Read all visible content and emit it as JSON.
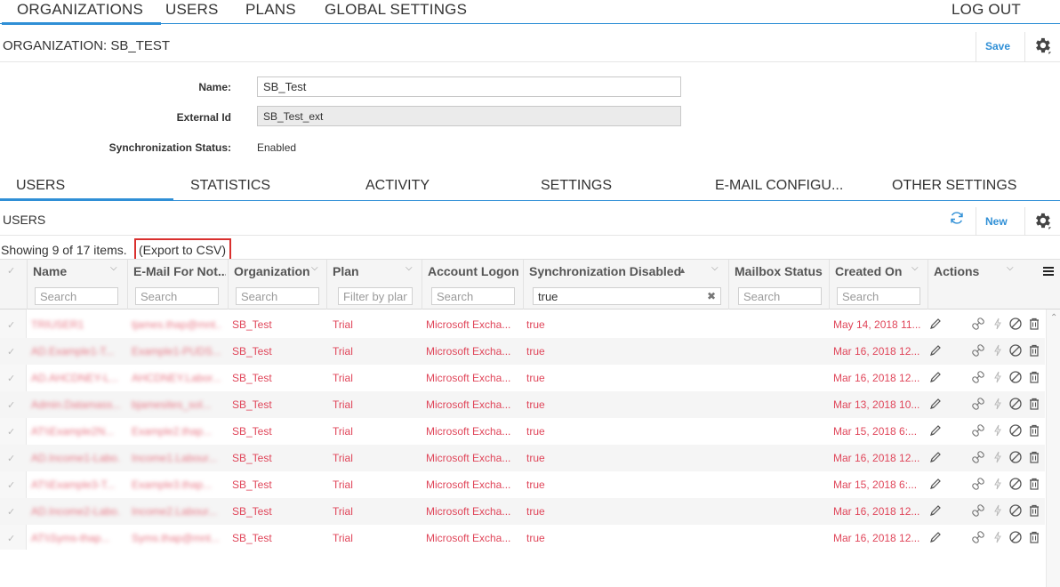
{
  "topnav": {
    "items": [
      "ORGANIZATIONS",
      "USERS",
      "PLANS",
      "GLOBAL SETTINGS"
    ],
    "logout": "LOG OUT"
  },
  "org": {
    "title": "ORGANIZATION: SB_TEST",
    "save": "Save",
    "fields": {
      "name_label": "Name:",
      "name_value": "SB_Test",
      "external_label": "External Id",
      "external_value": "SB_Test_ext",
      "sync_label": "Synchronization Status:",
      "sync_value": "Enabled"
    }
  },
  "subtabs": [
    "USERS",
    "STATISTICS",
    "ACTIVITY",
    "SETTINGS",
    "E-MAIL CONFIGU...",
    "OTHER SETTINGS"
  ],
  "users": {
    "title": "USERS",
    "new": "New",
    "showing": "Showing 9 of 17 items.",
    "export": "(Export to CSV)"
  },
  "grid": {
    "columns": [
      {
        "title": "Name",
        "placeholder": "Search"
      },
      {
        "title": "E-Mail For Not...",
        "placeholder": "Search"
      },
      {
        "title": "Organization",
        "placeholder": "Search"
      },
      {
        "title": "Plan",
        "placeholder": "Filter by plan"
      },
      {
        "title": "Account Logon",
        "placeholder": "Search"
      },
      {
        "title": "Synchronization Disabled",
        "placeholder": "",
        "value": "true"
      },
      {
        "title": "Mailbox Status",
        "placeholder": "Search"
      },
      {
        "title": "Created On",
        "placeholder": "Search"
      },
      {
        "title": "Actions",
        "placeholder": ""
      }
    ],
    "rows": [
      {
        "name": "TRIUSER1",
        "email": "tjames.thap@mnt...",
        "org": "SB_Test",
        "plan": "Trial",
        "logon": "Microsoft Excha...",
        "sync": "true",
        "created": "May 14, 2018 11..."
      },
      {
        "name": "AD.Example1-T...",
        "email": "Example1-PUDS...",
        "org": "SB_Test",
        "plan": "Trial",
        "logon": "Microsoft Excha...",
        "sync": "true",
        "created": "Mar 16, 2018 12..."
      },
      {
        "name": "AD.AHCDNEY-L...",
        "email": "AHCDNEY.Labor...",
        "org": "SB_Test",
        "plan": "Trial",
        "logon": "Microsoft Excha...",
        "sync": "true",
        "created": "Mar 16, 2018 12..."
      },
      {
        "name": "Admin.Datamass...",
        "email": "bjamesites_sol...",
        "org": "SB_Test",
        "plan": "Trial",
        "logon": "Microsoft Excha...",
        "sync": "true",
        "created": "Mar 13, 2018 10..."
      },
      {
        "name": "AT\\\\Example2N...",
        "email": "Example2.thap...",
        "org": "SB_Test",
        "plan": "Trial",
        "logon": "Microsoft Excha...",
        "sync": "true",
        "created": "Mar 15, 2018 6:..."
      },
      {
        "name": "AD.Income1-Labo...",
        "email": "Income1.Labour...",
        "org": "SB_Test",
        "plan": "Trial",
        "logon": "Microsoft Excha...",
        "sync": "true",
        "created": "Mar 16, 2018 12..."
      },
      {
        "name": "AT\\\\Example3-T...",
        "email": "Example3.thap...",
        "org": "SB_Test",
        "plan": "Trial",
        "logon": "Microsoft Excha...",
        "sync": "true",
        "created": "Mar 15, 2018 6:..."
      },
      {
        "name": "AD.Income2-Labo...",
        "email": "Income2.Labour...",
        "org": "SB_Test",
        "plan": "Trial",
        "logon": "Microsoft Excha...",
        "sync": "true",
        "created": "Mar 16, 2018 12..."
      },
      {
        "name": "AT\\\\Syms-thap...",
        "email": "Syms.thap@mnt...",
        "org": "SB_Test",
        "plan": "Trial",
        "logon": "Microsoft Excha...",
        "sync": "true",
        "created": "Mar 16, 2018 12..."
      }
    ]
  },
  "icons": {
    "gear": "gear-icon",
    "refresh": "refresh-icon",
    "menu": "hamburger-menu-icon",
    "edit": "pencil-icon",
    "link": "link-icon",
    "power": "power-bolt-icon",
    "disable": "disable-icon",
    "delete": "trash-icon"
  },
  "colors": {
    "accent": "#2f8fd6",
    "row_text": "#e0465a",
    "highlight": "#d9302e"
  }
}
